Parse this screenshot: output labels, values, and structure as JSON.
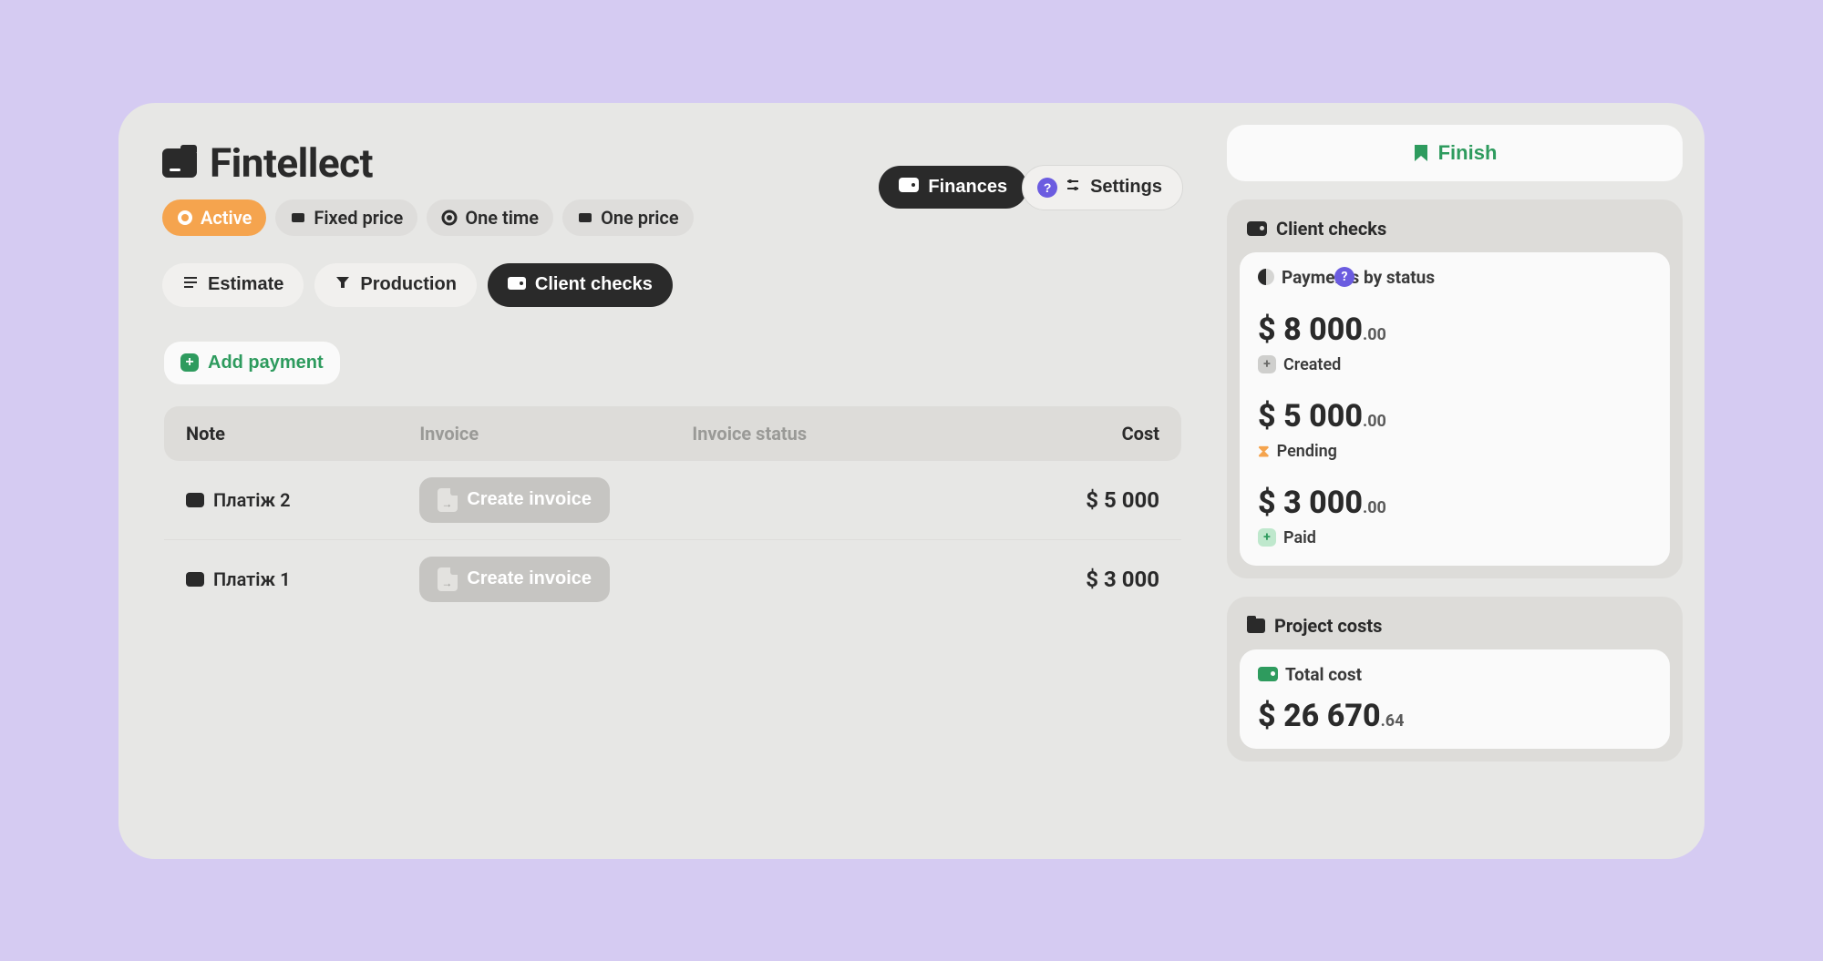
{
  "header": {
    "title": "Fintellect",
    "chips": [
      {
        "label": "Active",
        "active": true
      },
      {
        "label": "Fixed price",
        "active": false
      },
      {
        "label": "One time",
        "active": false
      },
      {
        "label": "One price",
        "active": false
      }
    ],
    "finances_label": "Finances",
    "settings_label": "Settings"
  },
  "tabs": [
    {
      "label": "Estimate",
      "active": false
    },
    {
      "label": "Production",
      "active": false
    },
    {
      "label": "Client checks",
      "active": true
    }
  ],
  "content": {
    "add_payment_label": "Add payment",
    "columns": {
      "note": "Note",
      "invoice": "Invoice",
      "invoice_status": "Invoice status",
      "cost": "Cost"
    },
    "rows": [
      {
        "note": "Платіж 2",
        "invoice_action": "Create invoice",
        "cost": "$ 5 000"
      },
      {
        "note": "Платіж 1",
        "invoice_action": "Create invoice",
        "cost": "$ 3 000"
      }
    ]
  },
  "side": {
    "finish_label": "Finish",
    "client_checks": {
      "title": "Client checks",
      "subtitle": "Payments by status",
      "statuses": [
        {
          "amount_main": "$ 8 000",
          "amount_cents": ".00",
          "label": "Created",
          "badge": "gray"
        },
        {
          "amount_main": "$ 5 000",
          "amount_cents": ".00",
          "label": "Pending",
          "badge": "hourglass"
        },
        {
          "amount_main": "$ 3 000",
          "amount_cents": ".00",
          "label": "Paid",
          "badge": "green"
        }
      ]
    },
    "project_costs": {
      "title": "Project costs",
      "subtitle": "Total cost",
      "amount_main": "$ 26 670",
      "amount_cents": ".64"
    }
  }
}
